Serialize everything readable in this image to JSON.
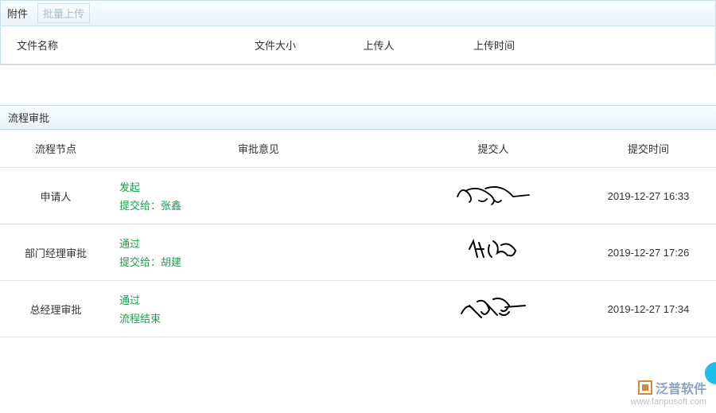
{
  "attachments": {
    "tab_label": "附件",
    "upload_btn": "批量上传",
    "columns": {
      "name": "文件名称",
      "size": "文件大小",
      "uploader": "上传人",
      "upload_time": "上传时间"
    }
  },
  "approval": {
    "title": "流程审批",
    "columns": {
      "node": "流程节点",
      "opinion": "审批意见",
      "submitter": "提交人",
      "submit_time": "提交时间"
    },
    "rows": [
      {
        "node": "申请人",
        "action": "发起",
        "detail": "提交给：张鑫",
        "time": "2019-12-27 16:33"
      },
      {
        "node": "部门经理审批",
        "action": "通过",
        "detail": "提交给：胡建",
        "time": "2019-12-27 17:26"
      },
      {
        "node": "总经理审批",
        "action": "通过",
        "detail": "流程结束",
        "time": "2019-12-27 17:34"
      }
    ]
  },
  "watermark": {
    "brand": "泛普软件",
    "url": "www.fanpusoft.com"
  }
}
